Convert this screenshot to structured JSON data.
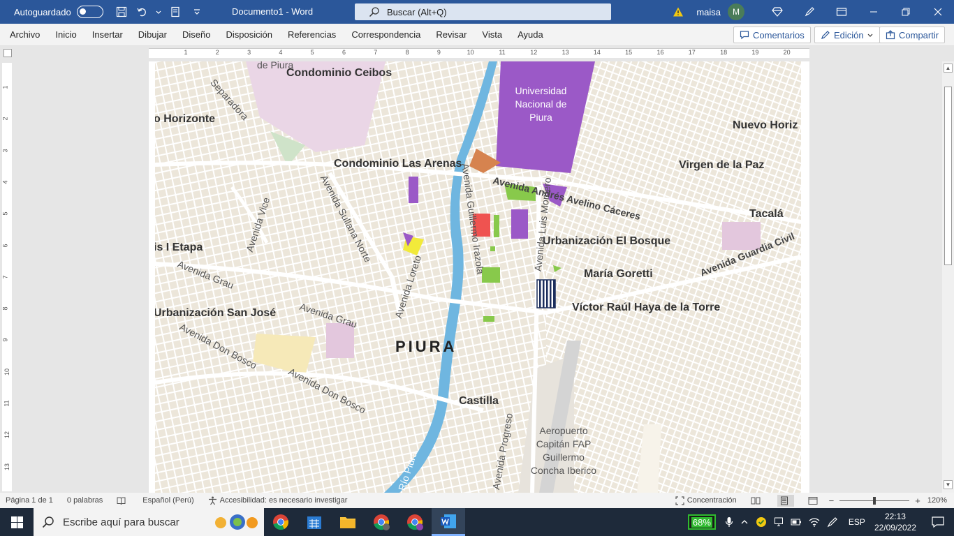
{
  "titlebar": {
    "autosave_label": "Autoguardado",
    "doc_title": "Documento1  -  Word",
    "search_placeholder": "Buscar (Alt+Q)",
    "user_name": "maisa",
    "avatar_initial": "M"
  },
  "ribbon": {
    "tabs": [
      "Archivo",
      "Inicio",
      "Insertar",
      "Dibujar",
      "Diseño",
      "Disposición",
      "Referencias",
      "Correspondencia",
      "Revisar",
      "Vista",
      "Ayuda"
    ],
    "comments_label": "Comentarios",
    "edit_label": "Edición",
    "share_label": "Compartir"
  },
  "ruler": {
    "h_ticks": [
      "1",
      "2",
      "3",
      "4",
      "5",
      "6",
      "7",
      "8",
      "9",
      "10",
      "11",
      "12",
      "13",
      "14",
      "15",
      "16",
      "17",
      "18",
      "19",
      "20"
    ],
    "v_ticks": [
      "1",
      "2",
      "3",
      "4",
      "5",
      "6",
      "7",
      "8",
      "9",
      "10",
      "11",
      "12",
      "13"
    ]
  },
  "map": {
    "labels": {
      "de_piura": "de Piura",
      "condominio_ceibos": "Condominio Ceibos",
      "separadora": "Separadora",
      "o_horizonte": "o Horizonte",
      "universidad": "Universidad Nacional de Piura",
      "nuevo_horiz": "Nuevo Horiz",
      "condominio_arenas": "Condominio Las Arenas",
      "virgen_paz": "Virgen de la Paz",
      "av_andres": "Avenida Andrés Avelino Cáceres",
      "av_sullana": "Avenida Sullana Norte",
      "av_guillermo": "Avenida Guillermo Irazola",
      "av_vice": "Avenida Vice",
      "tacala": "Tacalá",
      "urb_bosque": "Urbanización El Bosque",
      "av_luis": "Avenida Luis Montero",
      "av_loreto": "Avenida Loreto",
      "is_etapa": "is I Etapa",
      "maria_goretti": "María Goretti",
      "av_guardia": "Avenida Guardia Civil",
      "av_grau_1": "Avenida Grau",
      "victor_raul": "Víctor Raúl Haya de la Torre",
      "urb_san_jose": "Urbanización San José",
      "av_grau_2": "Avenida Grau",
      "piura": "PIURA",
      "av_don_bosco_1": "Avenida Don Bosco",
      "av_don_bosco_2": "Avenida Don Bosco",
      "castilla": "Castilla",
      "aeropuerto": "Aeropuerto Capitán FAP Guillermo Concha Iberico",
      "av_progreso": "Avenida Progreso",
      "rio_piura": "Río Piura"
    }
  },
  "statusbar": {
    "page": "Página 1 de 1",
    "words": "0 palabras",
    "language": "Español (Perú)",
    "accessibility": "Accesibilidad: es necesario investigar",
    "focus": "Concentración",
    "zoom": "120%"
  },
  "taskbar": {
    "search_placeholder": "Escribe aquí para buscar",
    "battery": "68%",
    "lang": "ESP",
    "time": "22:13",
    "date": "22/09/2022"
  }
}
